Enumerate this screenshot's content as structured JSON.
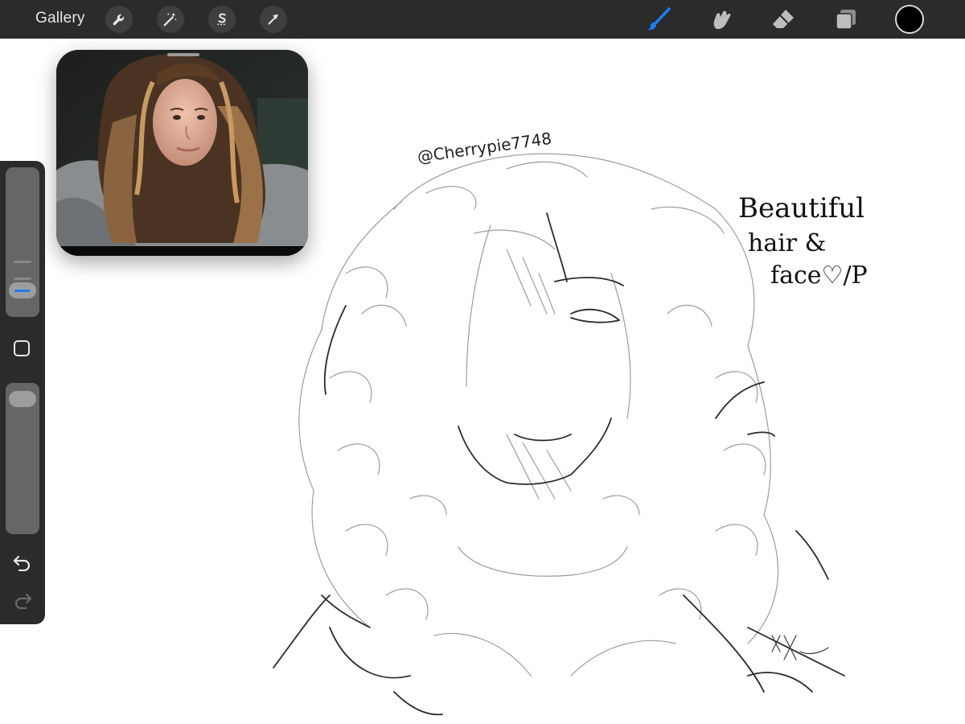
{
  "toolbar": {
    "gallery_label": "Gallery",
    "left_tools": [
      {
        "name": "actions",
        "icon": "wrench-icon"
      },
      {
        "name": "adjustments",
        "icon": "magic-wand-icon"
      },
      {
        "name": "selection",
        "icon": "selection-s-icon"
      },
      {
        "name": "transform",
        "icon": "arrow-cursor-icon"
      }
    ],
    "right_tools": [
      {
        "name": "brush",
        "icon": "brush-icon",
        "active": true
      },
      {
        "name": "smudge",
        "icon": "smudge-icon",
        "active": false
      },
      {
        "name": "eraser",
        "icon": "eraser-icon",
        "active": false
      },
      {
        "name": "layers",
        "icon": "layers-icon",
        "active": false
      }
    ],
    "active_color": "#000000",
    "accent_color": "#1e7cf2"
  },
  "reference_window": {
    "content": "webcam reference photo"
  },
  "sidebar": {
    "brush_size_level": 0.12,
    "opacity_level": 0.96,
    "icons": [
      "modify-square-icon",
      "undo-icon",
      "redo-icon"
    ]
  },
  "canvas": {
    "username_text": "@Cherrypie7748",
    "note_lines": [
      "Beautiful",
      "hair &",
      "face♡/P"
    ]
  }
}
